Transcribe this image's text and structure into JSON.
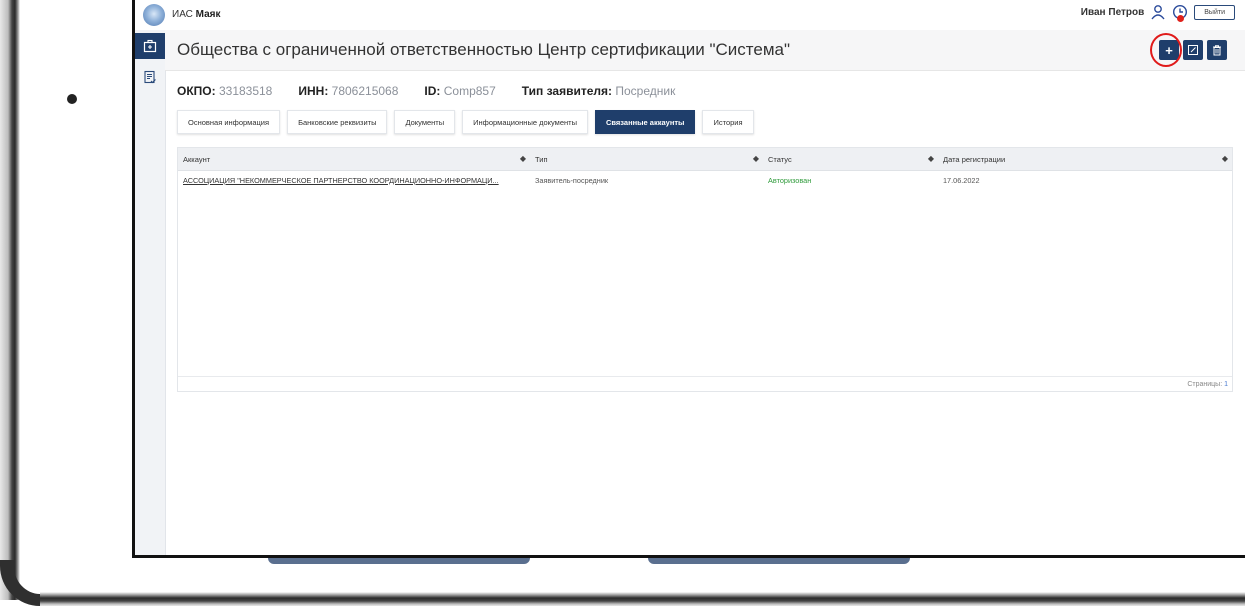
{
  "app": {
    "brand_prefix": "ИАС",
    "brand_name": "Маяк",
    "user_name": "Иван Петров",
    "logout_label": "Выйти"
  },
  "page": {
    "title": "Общества с ограниченной ответственностью Центр сертификации \"Система\"",
    "actions": {
      "add": "+",
      "edit_icon": "edit-icon",
      "delete_icon": "trash-icon"
    }
  },
  "info": [
    {
      "label": "ОКПО:",
      "value": "33183518"
    },
    {
      "label": "ИНН:",
      "value": "7806215068"
    },
    {
      "label": "ID:",
      "value": "Comp857"
    },
    {
      "label": "Тип заявителя:",
      "value": "Посредник"
    }
  ],
  "tabs": [
    {
      "label": "Основная информация",
      "active": false
    },
    {
      "label": "Банковские реквизиты",
      "active": false
    },
    {
      "label": "Документы",
      "active": false
    },
    {
      "label": "Информационные документы",
      "active": false
    },
    {
      "label": "Связанные аккаунты",
      "active": true
    },
    {
      "label": "История",
      "active": false
    }
  ],
  "table": {
    "columns": [
      "Аккаунт",
      "Тип",
      "Статус",
      "Дата регистрации"
    ],
    "rows": [
      {
        "account": "АССОЦИАЦИЯ \"НЕКОММЕРЧЕСКОЕ ПАРТНЕРСТВО КООРДИНАЦИОННО-ИНФОРМАЦИ...",
        "type": "Заявитель-посредник",
        "status": "Авторизован",
        "date": "17.06.2022"
      }
    ],
    "pager_label": "Страницы:",
    "pager_current": "1"
  },
  "colors": {
    "primary": "#1f3e6b",
    "status_ok": "#2e9a3a",
    "highlight": "#e01a1a"
  }
}
